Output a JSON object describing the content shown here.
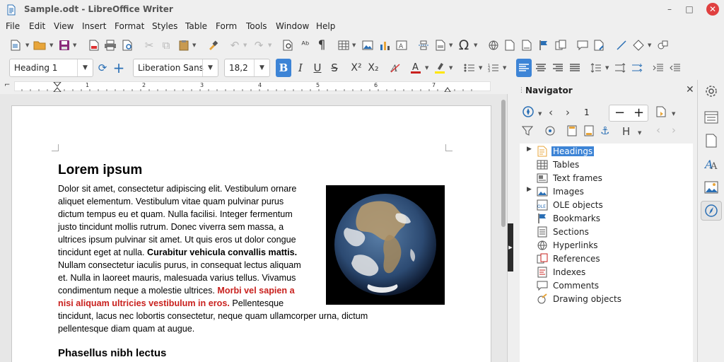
{
  "window": {
    "title": "Sample.odt - LibreOffice Writer",
    "controls": {
      "minimize": "–",
      "maximize": "□",
      "close": "✕"
    }
  },
  "menubar": {
    "items": [
      "File",
      "Edit",
      "View",
      "Insert",
      "Format",
      "Styles",
      "Table",
      "Form",
      "Tools",
      "Window",
      "Help"
    ]
  },
  "formatting": {
    "paragraph_style": "Heading 1",
    "font_name": "Liberation Sans",
    "font_size": "18,2"
  },
  "ruler": {
    "numbers": [
      "1",
      "2",
      "3",
      "4",
      "5",
      "6",
      "7"
    ]
  },
  "document": {
    "heading1": "Lorem ipsum",
    "lines": [
      "Dolor sit amet, consectetur adipiscing elit. Vestibulum ornare",
      "aliquet elementum. Vestibulum vitae quam pulvinar purus",
      "dictum tempus eu et quam. Nulla facilisi. Integer fermentum",
      "justo tincidunt mollis rutrum. Donec viverra sem massa, a",
      "ultrices ipsum pulvinar sit amet. Ut quis eros ut dolor congue"
    ],
    "line6_plain": "tincidunt eget at nulla. ",
    "line6_bold": "Curabitur vehicula convallis mattis.",
    "line7": "Nullam consectetur iaculis purus, in consequat lectus aliquam",
    "line8": "et. Nulla in laoreet mauris, malesuada varius tellus. Vivamus",
    "line9_plain": "condimentum neque a molestie ultrices. ",
    "line9_red": "Morbi vel sapien a",
    "line10_red": "nisi aliquam ultricies vestibulum in eros.",
    "line10_plain": " Pellentesque",
    "line11": "tincidunt, lacus nec lobortis consectetur, neque quam ullamcorper urna, dictum",
    "line12": "pellentesque diam quam at augue.",
    "heading2": "Phasellus nibh lectus"
  },
  "navigator": {
    "title": "Navigator",
    "page_number": "1",
    "categories": [
      {
        "label": "Headings",
        "icon": "headings-icon",
        "expandable": true,
        "selected": true
      },
      {
        "label": "Tables",
        "icon": "table-icon",
        "expandable": false,
        "selected": false
      },
      {
        "label": "Text frames",
        "icon": "frame-icon",
        "expandable": false,
        "selected": false
      },
      {
        "label": "Images",
        "icon": "image-icon",
        "expandable": true,
        "selected": false
      },
      {
        "label": "OLE objects",
        "icon": "ole-icon",
        "expandable": false,
        "selected": false
      },
      {
        "label": "Bookmarks",
        "icon": "bookmark-icon",
        "expandable": false,
        "selected": false
      },
      {
        "label": "Sections",
        "icon": "section-icon",
        "expandable": false,
        "selected": false
      },
      {
        "label": "Hyperlinks",
        "icon": "hyperlink-icon",
        "expandable": false,
        "selected": false
      },
      {
        "label": "References",
        "icon": "reference-icon",
        "expandable": false,
        "selected": false
      },
      {
        "label": "Indexes",
        "icon": "index-icon",
        "expandable": false,
        "selected": false
      },
      {
        "label": "Comments",
        "icon": "comment-icon",
        "expandable": false,
        "selected": false
      },
      {
        "label": "Drawing objects",
        "icon": "drawing-icon",
        "expandable": false,
        "selected": false
      }
    ]
  },
  "colors": {
    "accent": "#3d84d6",
    "red_text": "#c9211e",
    "font_color_bar": "#c9211e",
    "highlight_bar": "#ffe600"
  }
}
